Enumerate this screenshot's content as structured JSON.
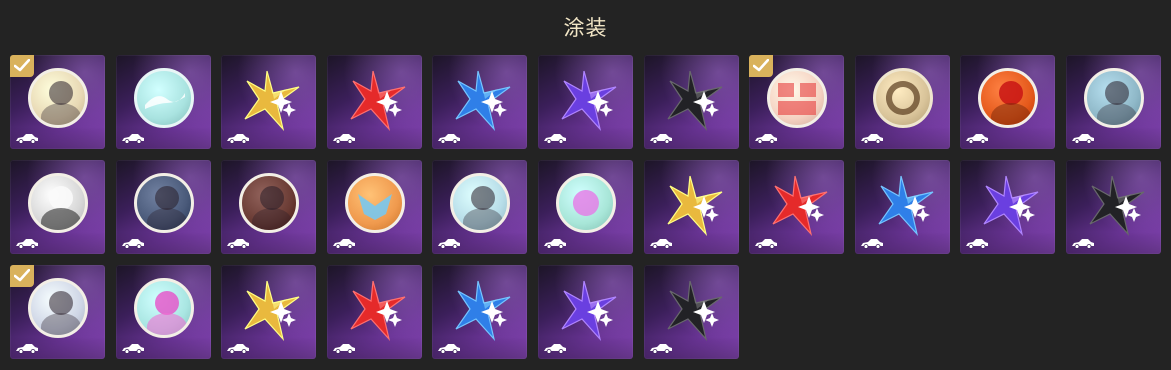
{
  "header": {
    "title": "涂装"
  },
  "colors": {
    "gold": "#e9b93e",
    "red": "#e52a2a",
    "blue": "#2f7fe8",
    "violet": "#6a3fe0",
    "black": "#222226",
    "check": "#d9b25c"
  },
  "icons": {
    "badge": "vehicle-icon",
    "selected": "check-icon",
    "sparkle": "sparkle-star-icon"
  },
  "tiles": [
    {
      "kind": "emblem",
      "bg": "#e8d9b5",
      "ring": "#f3efe6",
      "checked": true,
      "motif": "portrait"
    },
    {
      "kind": "emblem",
      "bg": "#a9e3e0",
      "ring": "#e8f6f6",
      "checked": false,
      "motif": "wave"
    },
    {
      "kind": "spark",
      "color": "gold",
      "checked": false
    },
    {
      "kind": "spark",
      "color": "red",
      "checked": false
    },
    {
      "kind": "spark",
      "color": "blue",
      "checked": false
    },
    {
      "kind": "spark",
      "color": "violet",
      "checked": false
    },
    {
      "kind": "spark",
      "color": "black",
      "checked": false
    },
    {
      "kind": "emblem",
      "bg": "#f5d2c2",
      "ring": "#f3efe6",
      "checked": true,
      "motif": "comic"
    },
    {
      "kind": "emblem",
      "bg": "#d9c49a",
      "ring": "#efe6cf",
      "checked": false,
      "motif": "ring"
    },
    {
      "kind": "emblem",
      "bg": "#e55a1c",
      "ring": "#f3efe6",
      "checked": false,
      "motif": "bird"
    },
    {
      "kind": "emblem",
      "bg": "#8fb8c8",
      "ring": "#f3efe6",
      "checked": false,
      "motif": "portrait"
    },
    {
      "kind": "emblem",
      "bg": "#d8d8d8",
      "ring": "#f3efe6",
      "checked": false,
      "motif": "mask"
    },
    {
      "kind": "emblem",
      "bg": "#4a5a7a",
      "ring": "#f3efe6",
      "checked": false,
      "motif": "portrait"
    },
    {
      "kind": "emblem",
      "bg": "#6a3b34",
      "ring": "#f3efe6",
      "checked": false,
      "motif": "portrait"
    },
    {
      "kind": "emblem",
      "bg": "#f09a4e",
      "ring": "#f3efe6",
      "checked": false,
      "motif": "wing"
    },
    {
      "kind": "emblem",
      "bg": "#b7dde8",
      "ring": "#f3efe6",
      "checked": false,
      "motif": "portrait"
    },
    {
      "kind": "emblem",
      "bg": "#a8e6d8",
      "ring": "#f3efe6",
      "checked": false,
      "motif": "orb"
    },
    {
      "kind": "spark",
      "color": "gold",
      "checked": false
    },
    {
      "kind": "spark",
      "color": "red",
      "checked": false
    },
    {
      "kind": "spark",
      "color": "blue",
      "checked": false
    },
    {
      "kind": "spark",
      "color": "violet",
      "checked": false
    },
    {
      "kind": "spark",
      "color": "black",
      "checked": false
    },
    {
      "kind": "emblem",
      "bg": "#cfd6e6",
      "ring": "#f3efe6",
      "checked": true,
      "motif": "portrait"
    },
    {
      "kind": "emblem",
      "bg": "#a9e6e2",
      "ring": "#f3efe6",
      "checked": false,
      "motif": "cat"
    },
    {
      "kind": "spark",
      "color": "gold",
      "checked": false
    },
    {
      "kind": "spark",
      "color": "red",
      "checked": false
    },
    {
      "kind": "spark",
      "color": "blue",
      "checked": false
    },
    {
      "kind": "spark",
      "color": "violet",
      "checked": false
    },
    {
      "kind": "spark",
      "color": "black",
      "checked": false
    }
  ]
}
